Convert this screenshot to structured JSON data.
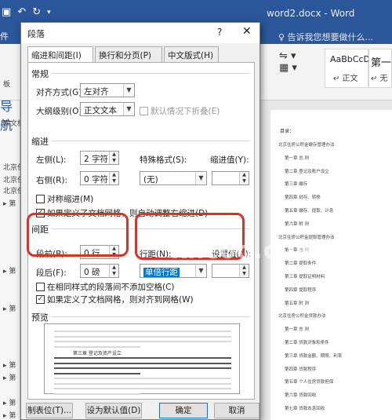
{
  "word": {
    "title_icons": [
      "save-icon",
      "undo-icon",
      "redo-icon"
    ],
    "doc_title": "word2.docx - Word",
    "file_tab": "件",
    "tell_me": "♀ 告诉我您想要做什么...",
    "styles": [
      {
        "preview": "AaBbCcDd",
        "name": "↵ 正文"
      },
      {
        "preview": "第一",
        "name": "↵ 无"
      }
    ],
    "nav_title": "导航",
    "nav_items": [
      "板",
      "索文档",
      "北京任",
      "北京任",
      "北京任",
      "▸ 第",
      "▸ 第",
      "▸ 第",
      "▸ 第",
      "▸ 第",
      "▸ 第",
      "▸ 第"
    ]
  },
  "dialog": {
    "title": "段落",
    "help": "?",
    "close": "✕",
    "tabs": [
      "缩进和间距(I)",
      "换行和分页(P)",
      "中文版式(H)"
    ],
    "general": {
      "section": "常规",
      "align_label": "对齐方式(G):",
      "align_value": "左对齐",
      "outline_label": "大纲级别(O):",
      "outline_value": "正文文本",
      "collapse_label": "默认情况下折叠(E)"
    },
    "indent": {
      "section": "缩进",
      "left_label": "左侧(L):",
      "left_value": "2 字符",
      "right_label": "右侧(R):",
      "right_value": "0 字符",
      "special_label": "特殊格式(S):",
      "special_value": "(无)",
      "by_label": "缩进值(Y):",
      "by_value": "",
      "mirror_label": "对称缩进(M)",
      "auto_right_label": "如果定义了文档网格，则自动调整右缩进(D)"
    },
    "spacing": {
      "section": "间距",
      "before_label": "段前(B):",
      "before_value": "0 行",
      "after_label": "段后(F):",
      "after_value": "0 磅",
      "line_label": "行距(N):",
      "line_value": "单倍行距",
      "at_label": "设置值(A):",
      "at_value": "",
      "no_space_label": "在相同样式的段落间不添加空格(C)",
      "snap_grid_label": "如果定义了文档网格，则对齐到网格(W)"
    },
    "preview": {
      "section": "预览",
      "sample_heading": "第三章 登记及资产设立"
    },
    "buttons": {
      "tabs": "制表位(T)...",
      "default": "设为默认值(D)",
      "ok": "确定",
      "cancel": "取消"
    }
  },
  "document": {
    "toc_label": "目录：",
    "toc_lines": [
      "北京住房公积金缴存管理办法",
      "第一章 总 则",
      "第二章 登记及账户设立",
      "第三章 缴存",
      "第四章 封存、转移",
      "第五章 缴存、提取、计息",
      "第六章 附 则",
      "北京住房公积金提取管理办法",
      "第一章 总 则",
      "第二章 提取条件",
      "第三章 提取证明材料",
      "第四章 提取程序",
      "第五章 附 则",
      "北京住房公积金贷款办法",
      "第一章 总 则",
      "第二章 贷款对象和条件",
      "第三章 贷款金额、期限、利率",
      "第四章 贷款程序",
      "第五章 个人住房贷款担保",
      "第六章 贷款回收",
      "第七章 贷款本息回收"
    ]
  },
  "watermark": "khcoo.com"
}
